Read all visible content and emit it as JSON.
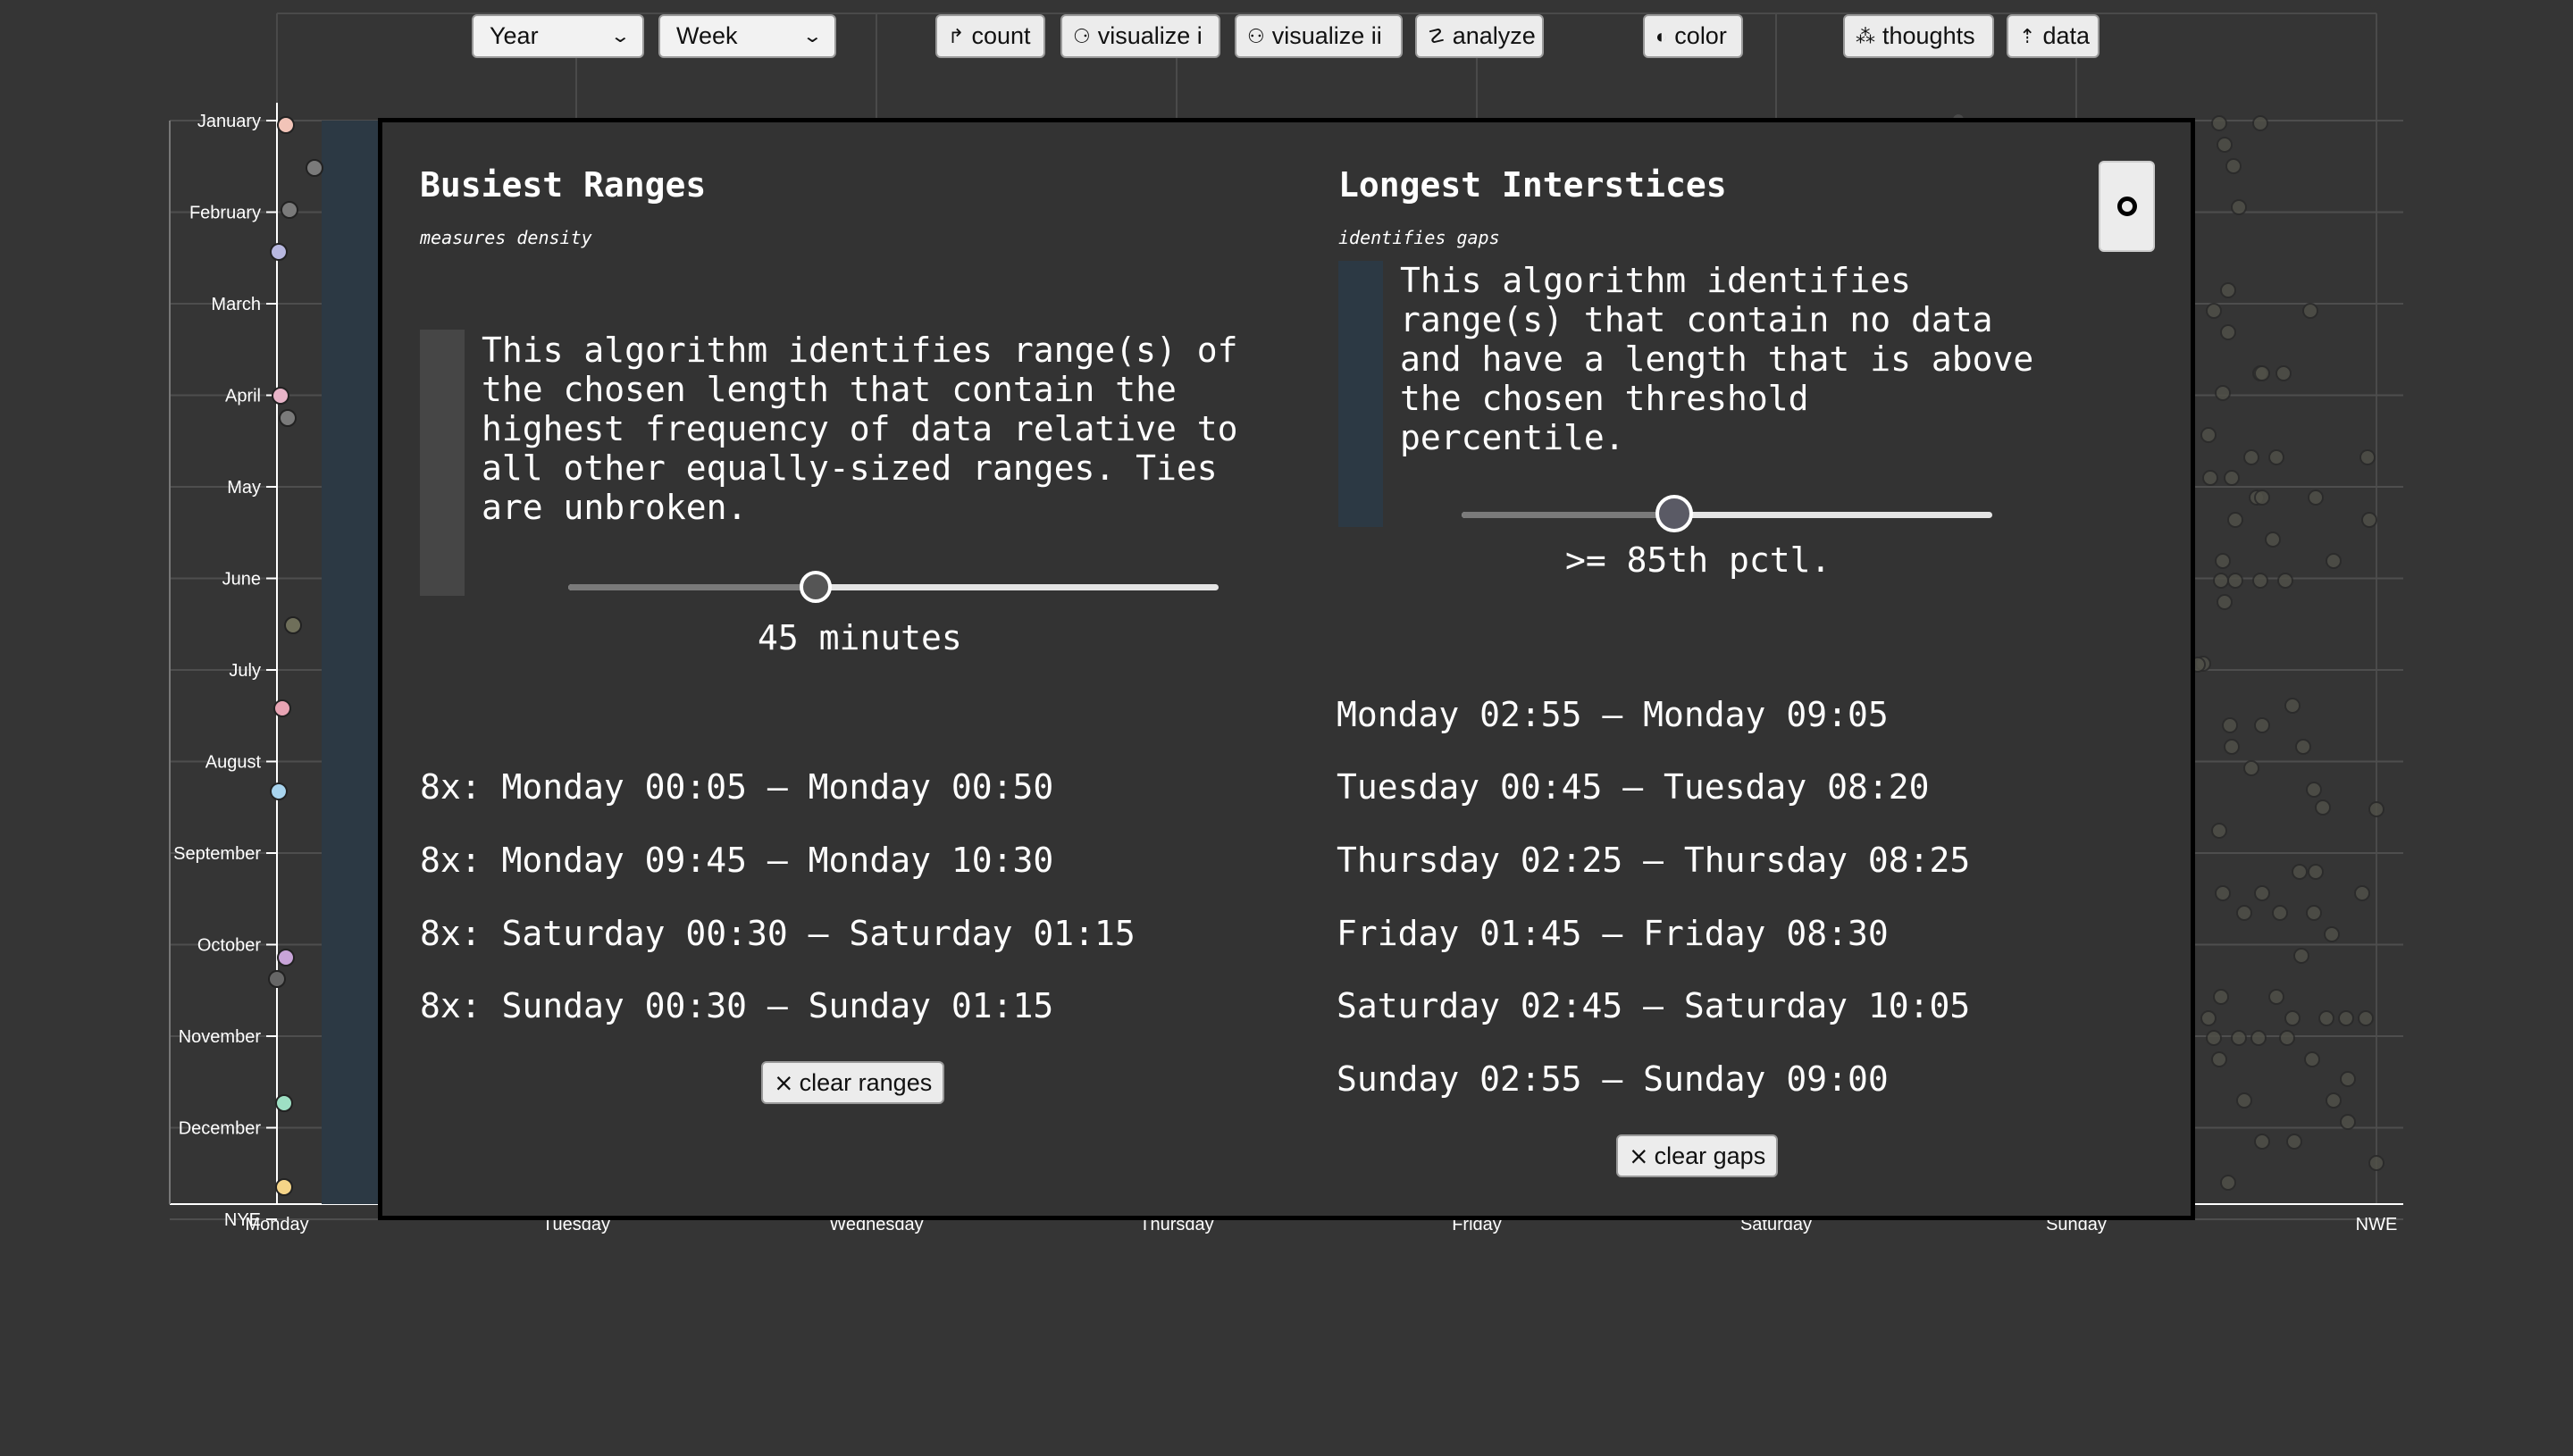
{
  "toolbar": {
    "period_select": "Year",
    "interval_select": "Week",
    "buttons": [
      {
        "icon": "↱",
        "label": "count"
      },
      {
        "icon": "⚆",
        "label": "visualize i"
      },
      {
        "icon": "⚇",
        "label": "visualize ii"
      },
      {
        "icon": "☡",
        "label": "analyze"
      },
      {
        "icon": "◐",
        "label": "color"
      },
      {
        "icon": "⁂",
        "label": "thoughts"
      },
      {
        "icon": "⇡",
        "label": "data"
      }
    ]
  },
  "chart_data": {
    "type": "scatter",
    "y_categories": [
      "January",
      "February",
      "March",
      "April",
      "May",
      "June",
      "July",
      "August",
      "September",
      "October",
      "November",
      "December",
      "NYE"
    ],
    "x_categories": [
      "Monday",
      "Tuesday",
      "Wednesday",
      "Thursday",
      "Friday",
      "Saturday",
      "Sunday",
      "NWE"
    ],
    "axis_color": "#ffffff",
    "grid": true
  },
  "modal": {
    "close_icon": "circle-icon",
    "busiest": {
      "title": "Busiest Ranges",
      "subtitle": "measures density",
      "description": "This algorithm identifies range(s) of\nthe chosen length that contain the\nhighest frequency of data relative to\nall other equally-sized ranges. Ties\nare unbroken.",
      "slider_fraction": 0.38,
      "slider_label": "45 minutes",
      "results": [
        "8x: Monday 00:05 – Monday 00:50",
        "8x: Monday 09:45 – Monday 10:30",
        "8x: Saturday 00:30 – Saturday 01:15",
        "8x: Sunday 00:30 – Sunday 01:15"
      ],
      "clear_label": "clear ranges"
    },
    "interstices": {
      "title": "Longest Interstices",
      "subtitle": "identifies gaps",
      "description": "This algorithm identifies\nrange(s) that contain no data\nand have a length that is above\nthe chosen threshold\npercentile.",
      "slider_fraction": 0.4,
      "slider_label": ">= 85th pctl.",
      "results": [
        "Monday 02:55 – Monday 09:05",
        "Tuesday 00:45 – Tuesday 08:20",
        "Thursday 02:25 – Thursday 08:25",
        "Friday 01:45 – Friday 08:30",
        "Saturday 02:45 – Saturday 10:05",
        "Sunday 02:55 – Sunday 09:00"
      ],
      "clear_label": "clear gaps"
    }
  }
}
